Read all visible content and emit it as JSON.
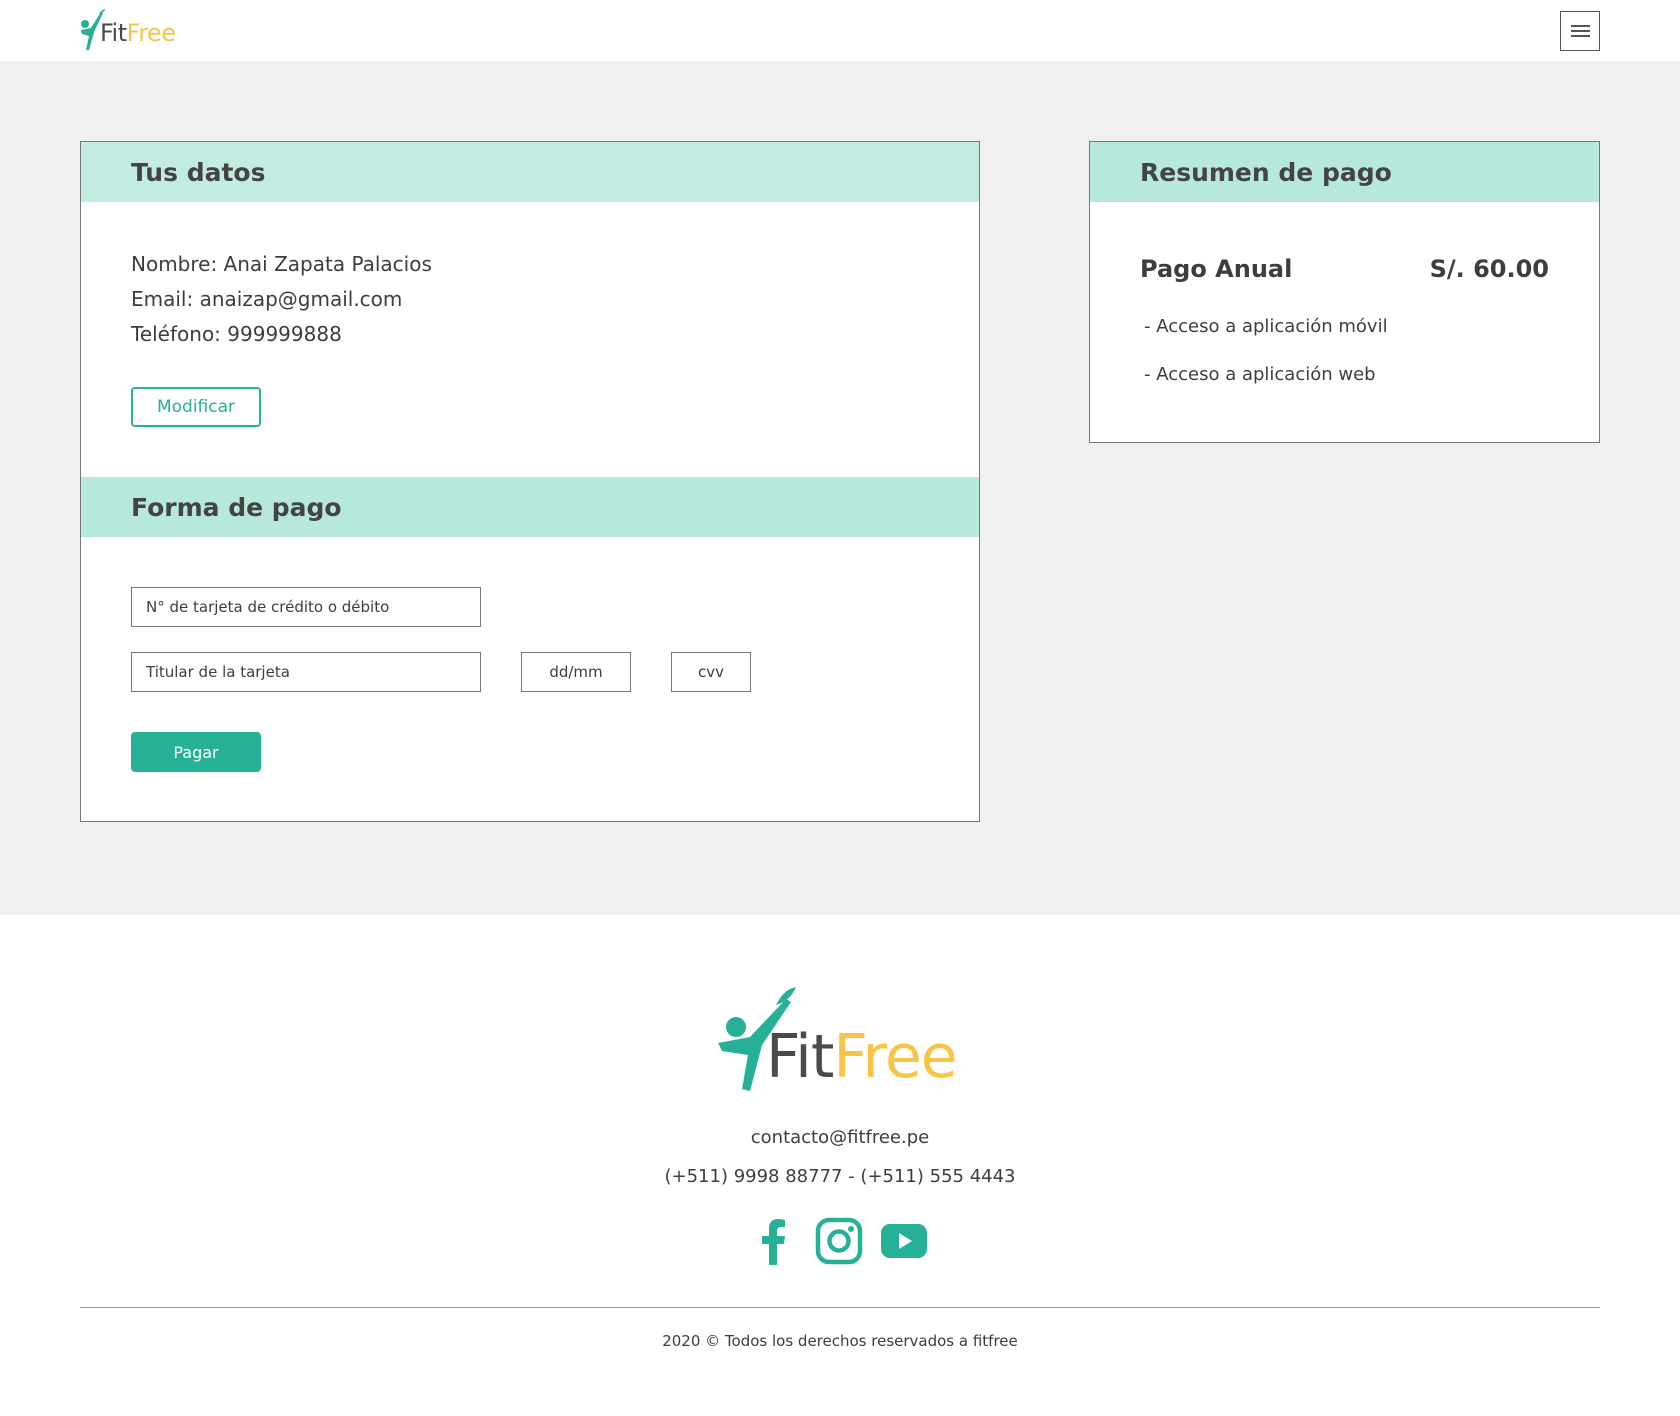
{
  "header": {
    "brand_part1": "Fit",
    "brand_part2": "Free",
    "menu_icon": "hamburger-menu-icon"
  },
  "personal": {
    "title": "Tus datos",
    "name_line": "Nombre: Anai Zapata Palacios",
    "email_line": "Email: anaizap@gmail.com",
    "phone_line": "Teléfono: 999999888",
    "modify_label": "Modificar"
  },
  "payment": {
    "title": "Forma de pago",
    "card_number_placeholder": "N° de tarjeta de crédito o débito",
    "card_holder_placeholder": "Titular de la tarjeta",
    "expiry_placeholder": "dd/mm",
    "cvv_placeholder": "cvv",
    "pay_label": "Pagar"
  },
  "summary": {
    "title": "Resumen de pago",
    "plan_name": "Pago Anual",
    "plan_price": "S/. 60.00",
    "features": [
      "- Acceso a aplicación móvil",
      "- Acceso a aplicación web"
    ]
  },
  "footer": {
    "brand_part1": "Fit",
    "brand_part2": "Free",
    "email": "contacto@fitfree.pe",
    "phones": "(+511) 9998 88777 - (+511) 555 4443",
    "social_icons": [
      "facebook-icon",
      "instagram-icon",
      "youtube-icon"
    ],
    "copyright": "2020 © Todos los derechos reservados a fitfree"
  },
  "colors": {
    "accent": "#26b095",
    "section_header": "#b6e8dc",
    "brand_yellow": "#f7c446",
    "background": "#f0f0f0"
  }
}
